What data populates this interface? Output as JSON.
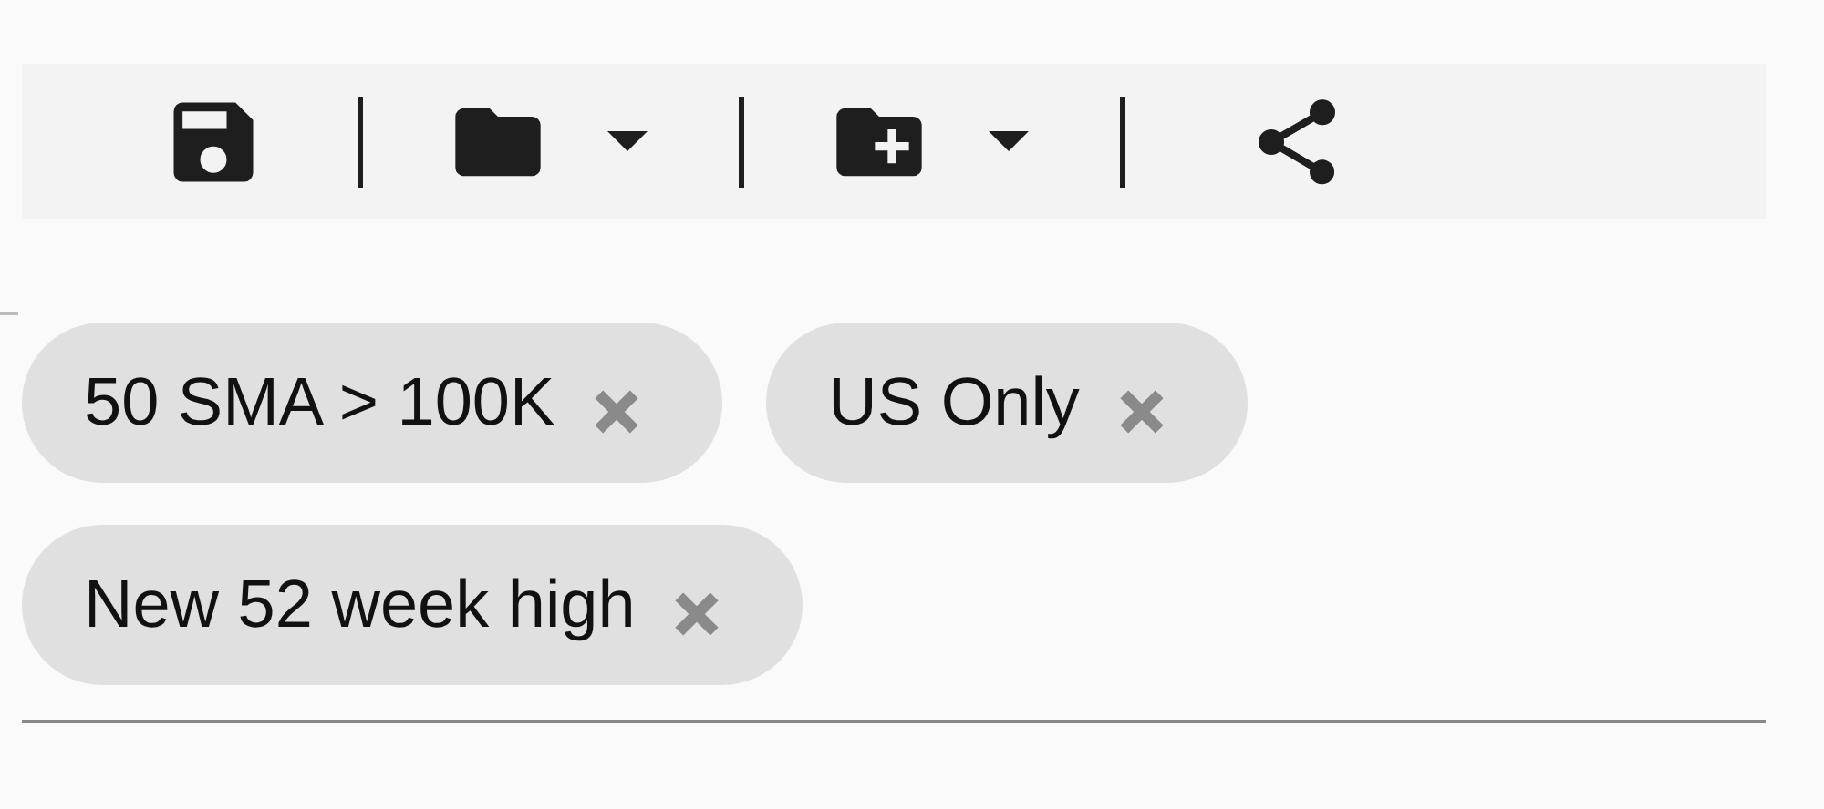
{
  "toolbar": [
    {
      "kind": "save",
      "dropdown": false
    },
    {
      "kind": "open",
      "dropdown": true
    },
    {
      "kind": "new-folder",
      "dropdown": true
    },
    {
      "kind": "share",
      "dropdown": false
    }
  ],
  "filters": [
    {
      "label": "50 SMA > 100K"
    },
    {
      "label": "US Only"
    },
    {
      "label": "New 52 week high"
    }
  ]
}
